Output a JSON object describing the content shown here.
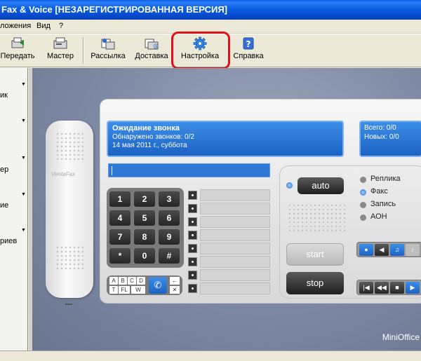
{
  "window": {
    "title": "Fax & Voice [НЕЗАРЕГИСТРИРОВАННАЯ ВЕРСИЯ]"
  },
  "menu": {
    "items": [
      "ложения",
      "Вид",
      "?"
    ]
  },
  "toolbar": {
    "buttons": [
      {
        "label": "Передать",
        "icon": "send-fax-icon"
      },
      {
        "label": "Мастер",
        "icon": "wizard-icon"
      },
      {
        "label": "Рассылка",
        "icon": "mailing-icon"
      },
      {
        "label": "Доставка",
        "icon": "delivery-icon"
      },
      {
        "label": "Настройка",
        "icon": "gear-icon"
      },
      {
        "label": "Справка",
        "icon": "help-icon"
      }
    ],
    "highlight_color": "#e0101a"
  },
  "sidebar": {
    "items": [
      "ик",
      "ер",
      "ие",
      "риев"
    ]
  },
  "device": {
    "brand_on_handset": "VentaFax",
    "status_line1": "Ожидание звонка",
    "status_line2": "Обнаружено звонков: 0/2",
    "status_line3": "14 мая 2011 г., суббота",
    "counter_total": "Всего: 0/0",
    "counter_new": "Новых: 0/0",
    "keys": [
      "1",
      "2",
      "3",
      "4",
      "5",
      "6",
      "7",
      "8",
      "9",
      "*",
      "0",
      "#"
    ],
    "letter_keys": [
      "A",
      "B",
      "C",
      "D",
      "T",
      "FL",
      "W"
    ],
    "auto_label": "auto",
    "start_label": "start",
    "stop_label": "stop",
    "modes": [
      "Реплика",
      "Факс",
      "Запись",
      "АОН"
    ],
    "active_mode": "Факс",
    "accent": "#2e79d6"
  },
  "footer": {
    "brand": "MiniOffice"
  }
}
